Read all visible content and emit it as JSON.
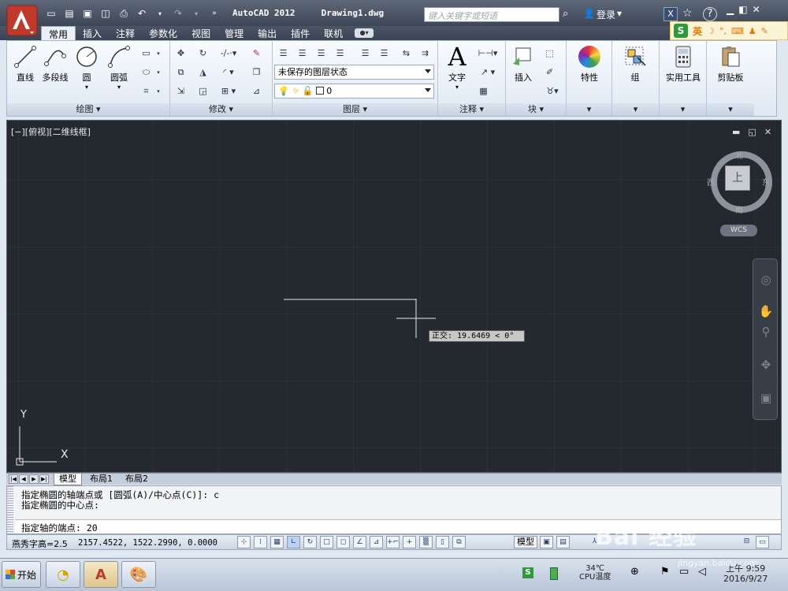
{
  "app": {
    "title": "AutoCAD 2012",
    "document": "Drawing1.dwg"
  },
  "search": {
    "placeholder": "键入关键字或短语"
  },
  "user": {
    "login": "登录"
  },
  "ime": {
    "lang": "英"
  },
  "tabs": [
    "常用",
    "插入",
    "注释",
    "参数化",
    "视图",
    "管理",
    "输出",
    "插件",
    "联机"
  ],
  "ribbon": {
    "draw": {
      "title": "绘图",
      "line": "直线",
      "polyline": "多段线",
      "circle": "圆",
      "arc": "圆弧"
    },
    "modify": {
      "title": "修改"
    },
    "layers": {
      "title": "图层",
      "state": "未保存的图层状态",
      "current": "0"
    },
    "annotation": {
      "title": "注释",
      "text": "文字"
    },
    "block": {
      "title": "块",
      "insert": "插入"
    },
    "properties": {
      "label": "特性"
    },
    "group": {
      "label": "组"
    },
    "utilities": {
      "label": "实用工具"
    },
    "clipboard": {
      "label": "剪贴板"
    }
  },
  "viewport": {
    "label": "[−][俯视][二维线框]"
  },
  "viewcube": {
    "north": "北",
    "south": "南",
    "east": "东",
    "west": "西",
    "top": "上",
    "wcs": "WCS"
  },
  "tooltip": "正交: 19.6469 < 0°",
  "ucs": {
    "x": "X",
    "y": "Y"
  },
  "layout_tabs": [
    "模型",
    "布局1",
    "布局2"
  ],
  "command": {
    "history": [
      "指定椭圆的轴端点或 [圆弧(A)/中心点(C)]: c",
      "指定椭圆的中心点:"
    ],
    "input": "指定轴的端点: 20"
  },
  "status": {
    "text": "燕秀字高=2.5",
    "coords": "2157.4522, 1522.2990, 0.0000",
    "model": "模型"
  },
  "taskbar": {
    "start": "开始"
  },
  "tray": {
    "temp": "34℃",
    "cpu": "CPU温度",
    "time": "9:59",
    "ampm": "上午",
    "date": "2016/9/27"
  },
  "watermark": {
    "text": "Bai 经验",
    "url": "jingyan.baidu.com"
  },
  "colors": {
    "canvas": "#24292f",
    "titlebar": "#4a5566",
    "accent": "#c0392b"
  }
}
